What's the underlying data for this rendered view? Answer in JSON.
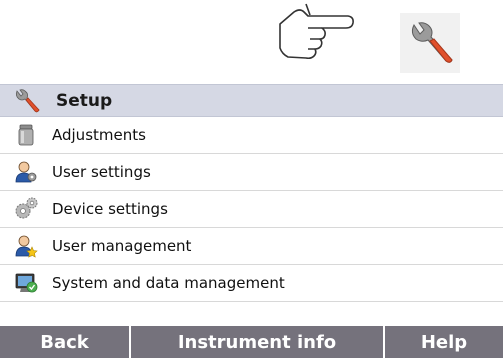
{
  "illustration": {
    "hand_icon": "pointing-hand-icon",
    "wrench_icon": "wrench-icon"
  },
  "header": {
    "icon": "wrench-icon",
    "title": "Setup"
  },
  "menu": {
    "items": [
      {
        "icon": "adjustment-weight-icon",
        "label": "Adjustments"
      },
      {
        "icon": "user-settings-icon",
        "label": "User settings"
      },
      {
        "icon": "device-gears-icon",
        "label": "Device settings"
      },
      {
        "icon": "user-management-icon",
        "label": "User management"
      },
      {
        "icon": "system-data-icon",
        "label": "System and data management"
      }
    ]
  },
  "bottom_bar": {
    "back": "Back",
    "instrument_info": "Instrument info",
    "help": "Help"
  },
  "colors": {
    "header_bg": "#d5d8e4",
    "bar_bg": "#75727c",
    "wrench": "#e0502c"
  }
}
